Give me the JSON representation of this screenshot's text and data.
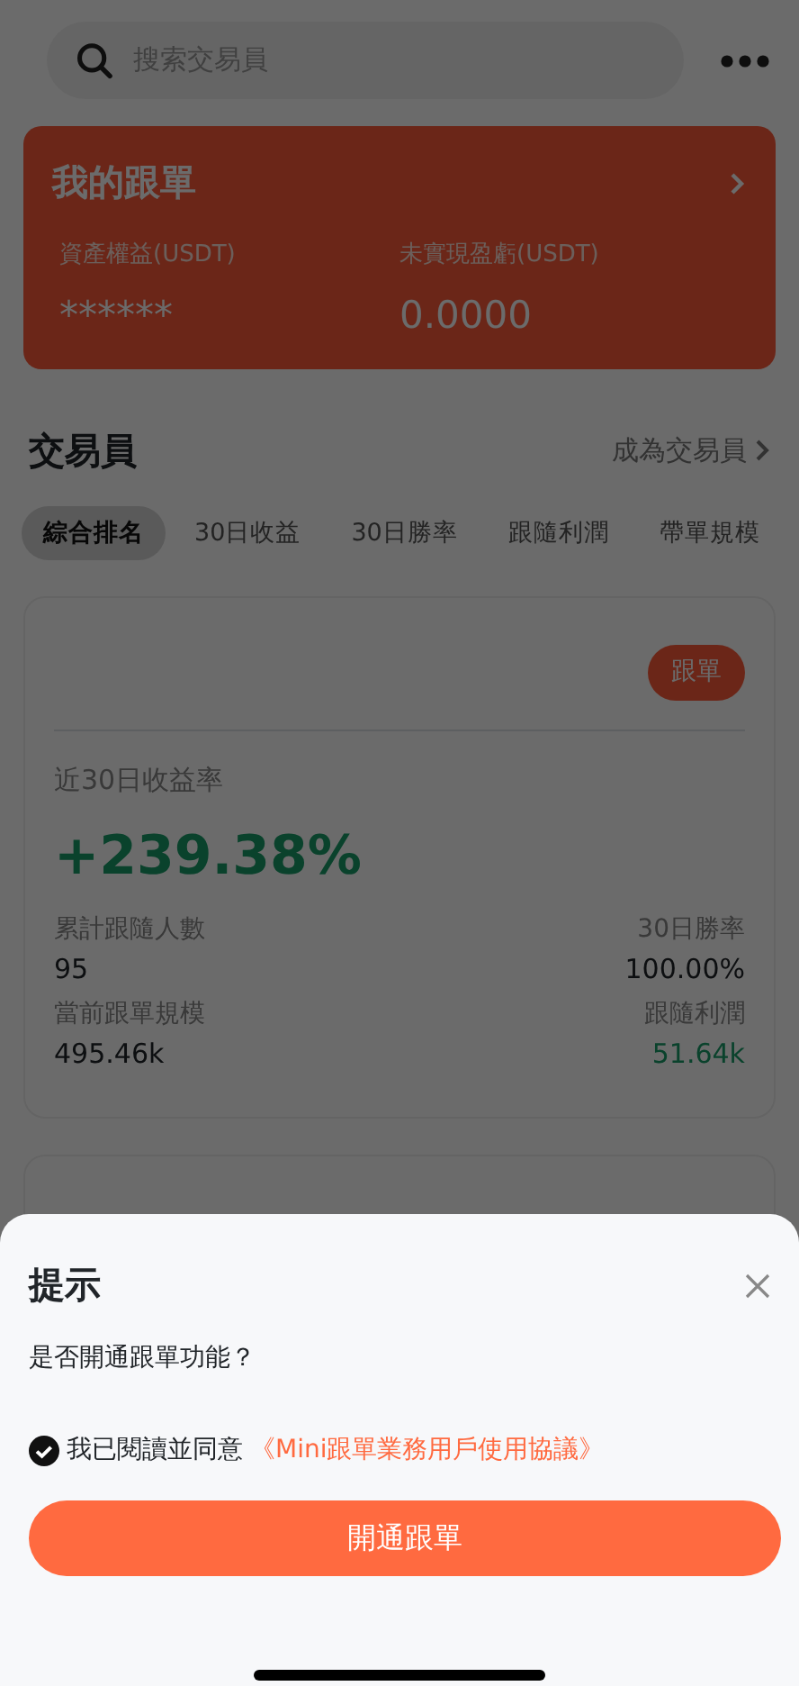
{
  "search": {
    "placeholder": "搜索交易員"
  },
  "my_copy": {
    "title": "我的跟單",
    "stats": [
      {
        "label": "資產權益(USDT)",
        "value": "******"
      },
      {
        "label": "未實現盈虧(USDT)",
        "value": "0.0000"
      }
    ]
  },
  "traders": {
    "title": "交易員",
    "link": "成為交易員",
    "tabs": [
      {
        "label": "綜合排名",
        "selected": true
      },
      {
        "label": "30日收益",
        "selected": false
      },
      {
        "label": "30日勝率",
        "selected": false
      },
      {
        "label": "跟隨利潤",
        "selected": false
      },
      {
        "label": "帶單規模",
        "selected": false
      }
    ],
    "card": {
      "follow": "跟單",
      "metric_label": "近30日收益率",
      "metric": "+239.38%",
      "stats": [
        {
          "label": "累計跟隨人數",
          "value": "95",
          "positive": false
        },
        {
          "label": "30日勝率",
          "value": "100.00%",
          "positive": false
        },
        {
          "label": "當前跟單規模",
          "value": "495.46k",
          "positive": false
        },
        {
          "label": "跟隨利潤",
          "value": "51.64k",
          "positive": true
        }
      ]
    }
  },
  "dialog": {
    "title": "提示",
    "message": "是否開通跟單功能？",
    "agreement": {
      "checked": true,
      "text": "我已閱讀並同意",
      "link": "《Mini跟單業務用戶使用協議》"
    },
    "button": "開通跟單"
  }
}
